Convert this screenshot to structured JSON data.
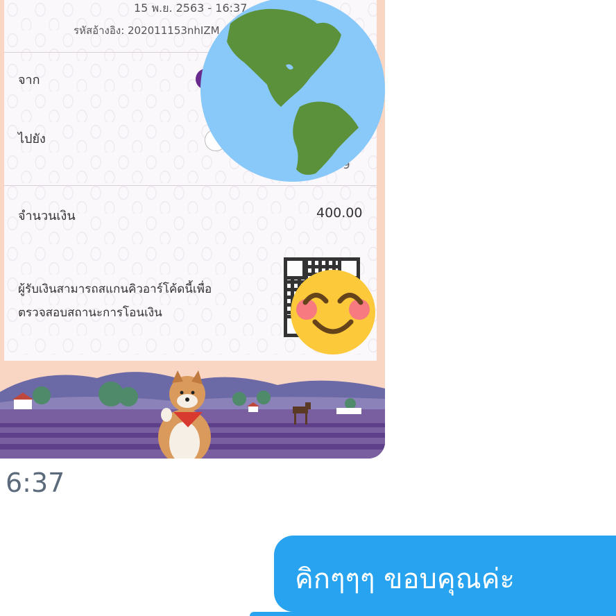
{
  "slip": {
    "datetime": "15 พ.ย. 2563 - 16:37",
    "reference": "รหัสอ้างอิง: 202011153nhIZM",
    "from_label": "จาก",
    "to_label": "ไปยัง",
    "to_account_tail": "369",
    "amount_label": "จำนวนเงิน",
    "amount_value": "400.00",
    "qr_note_line1": "ผู้รับเงินสามารถสแกนคิวอาร์โค้ดนี้เพื่อ",
    "qr_note_line2": "ตรวจสอบสถานะการโอนเงิน"
  },
  "stickers": {
    "globe": "globe-americas-icon",
    "smiley": "smiling-face-with-smiling-eyes-icon"
  },
  "chat": {
    "timestamp": "6:37",
    "outgoing_message": "คิกๆๆๆ ขอบคุณค่ะ"
  },
  "colors": {
    "bubble": "#27a3ef",
    "slip_border": "#f9d5c4",
    "timestamp": "#5b6b7b"
  }
}
